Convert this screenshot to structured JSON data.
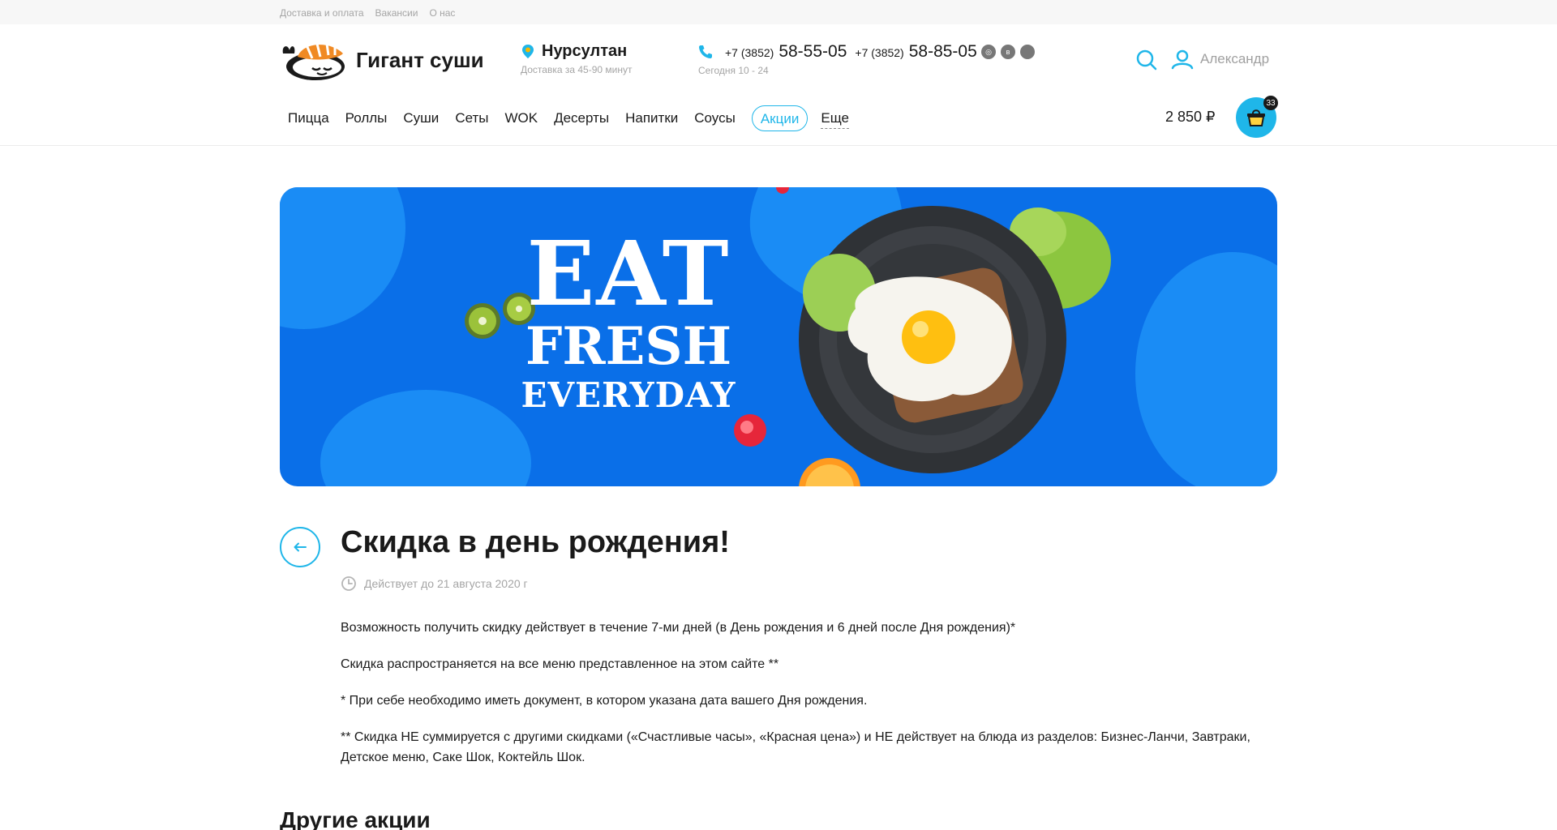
{
  "topbar": {
    "links": [
      "Доставка и оплата",
      "Вакансии",
      "О нас"
    ]
  },
  "header": {
    "brand": "Гигант суши",
    "city": "Нурсултан",
    "delivery_time": "Доставка за 45-90 минут",
    "phones": [
      {
        "prefix": "+7 (3852)",
        "number": "58-55-05"
      },
      {
        "prefix": "+7 (3852)",
        "number": "58-85-05"
      }
    ],
    "hours": "Сегодня 10 - 24",
    "user_name": "Александр",
    "cart_total": "2 850 ₽",
    "cart_count": "33"
  },
  "nav": {
    "items": [
      "Пицца",
      "Роллы",
      "Суши",
      "Сеты",
      "WOK",
      "Десерты",
      "Напитки",
      "Соусы",
      "Акции"
    ],
    "more": "Еще"
  },
  "banner": {
    "line1": "EAT",
    "line2": "FRESH",
    "line3": "EVERYDAY"
  },
  "promo": {
    "title": "Скидка в день рождения!",
    "valid_until": "Действует до 21 августа 2020 г",
    "paragraphs": [
      "Возможность получить скидку действует в течение 7-ми дней (в День рождения и 6 дней после Дня рождения)*",
      "Скидка распространяется на все меню представленное на этом сайте **",
      "* При себе необходимо иметь документ, в котором указана дата вашего Дня рождения.",
      "** Скидка НЕ суммируется с другими скидками («Счастливые часы», «Красная цена») и НЕ действует на блюда из разделов: Бизнес-Ланчи, Завтраки, Детское меню, Саке Шок, Коктейль Шок."
    ]
  },
  "other_promos_title": "Другие акции",
  "colors": {
    "accent": "#1fb6e9",
    "banner_bg": "#0a6fe8",
    "muted_text": "#a5a5a5"
  }
}
